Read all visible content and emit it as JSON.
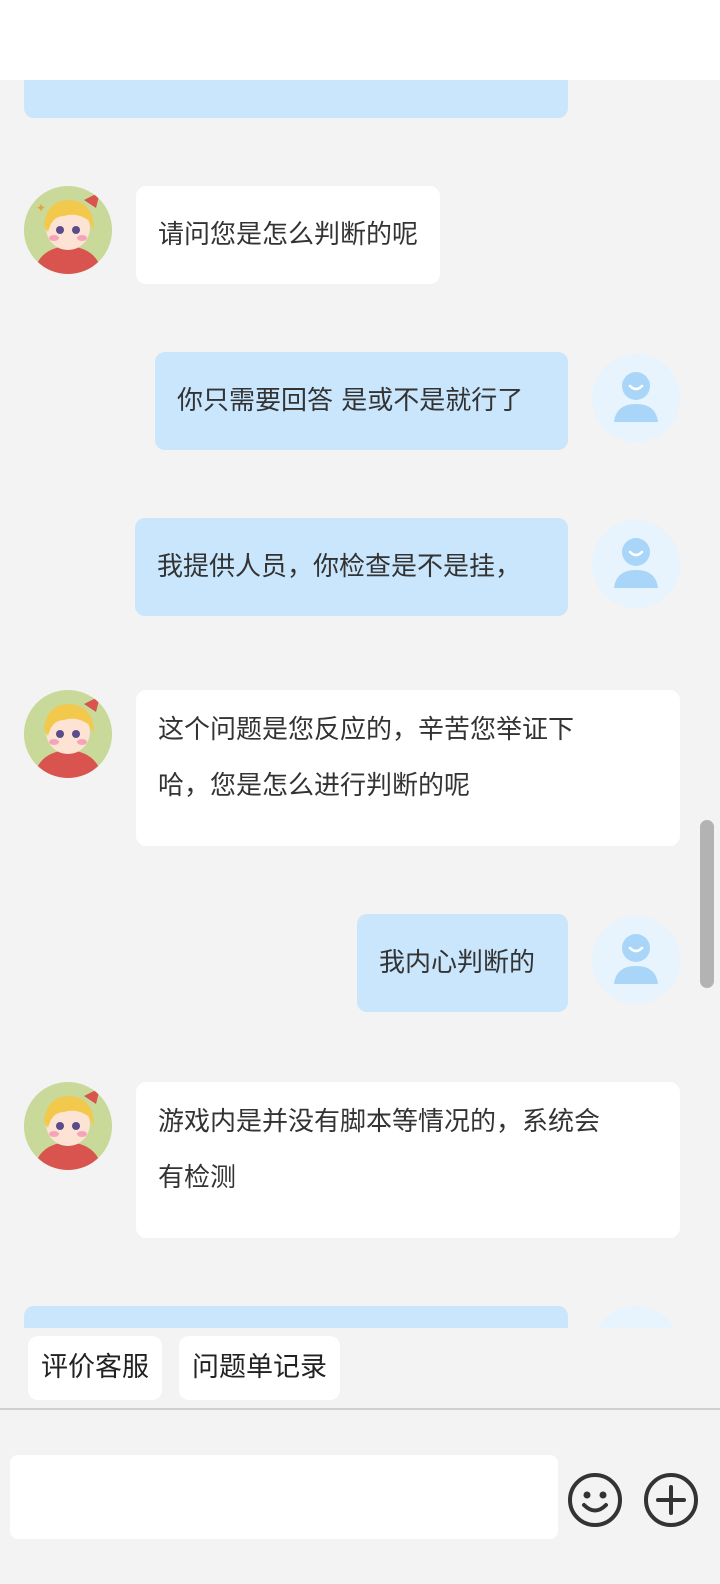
{
  "messages": {
    "m1": "请问您是怎么判断的呢",
    "m2": "你只需要回答 是或不是就行了",
    "m3": "我提供人员，你检查是不是挂，",
    "m4_line1": "这个问题是您反应的，辛苦您举证下",
    "m4_line2": "哈，您是怎么进行判断的呢",
    "m5": "我内心判断的",
    "m6_line1": "游戏内是并没有脚本等情况的，系统会",
    "m6_line2": "有检测"
  },
  "quick_actions": {
    "rate_service": "评价客服",
    "ticket_records": "问题单记录"
  },
  "input": {
    "value": "",
    "placeholder": ""
  },
  "icons": {
    "emoji": "smiley-face-icon",
    "add": "plus-circle-icon",
    "agent_avatar": "anime-girl-avatar",
    "user_avatar": "default-user-avatar"
  },
  "colors": {
    "user_bubble": "#c9e6fc",
    "agent_bubble": "#ffffff",
    "background": "#f3f3f3"
  }
}
